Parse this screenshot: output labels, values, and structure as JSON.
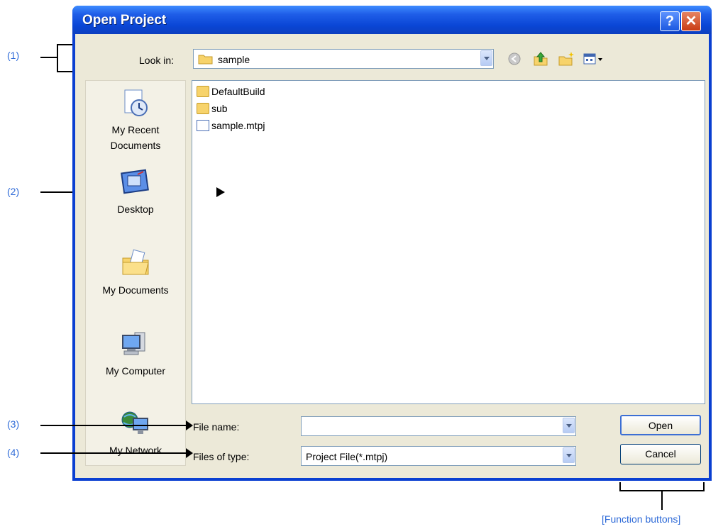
{
  "window": {
    "title": "Open Project",
    "help_glyph": "?",
    "close_glyph": "✕"
  },
  "look_in": {
    "label": "Look in:",
    "value": "sample"
  },
  "toolbar": {
    "icons": [
      "back-icon",
      "up-folder-icon",
      "new-folder-icon",
      "views-menu-icon"
    ]
  },
  "places": [
    {
      "label": "My Recent Documents",
      "icon": "recent-documents-icon"
    },
    {
      "label": "Desktop",
      "icon": "desktop-icon"
    },
    {
      "label": "My Documents",
      "icon": "my-documents-icon"
    },
    {
      "label": "My Computer",
      "icon": "my-computer-icon"
    },
    {
      "label": "My Network",
      "icon": "my-network-icon"
    }
  ],
  "files": [
    {
      "name": "DefaultBuild",
      "type": "folder"
    },
    {
      "name": "sub",
      "type": "folder"
    },
    {
      "name": "sample.mtpj",
      "type": "file"
    }
  ],
  "file_name": {
    "label": "File name:",
    "value": ""
  },
  "files_of_type": {
    "label": "Files of type:",
    "value": "Project File(*.mtpj)"
  },
  "buttons": {
    "open": "Open",
    "cancel": "Cancel"
  },
  "annotations": {
    "c1": "(1)",
    "c2": "(2)",
    "c3": "(3)",
    "c4": "(4)",
    "function_buttons": "[Function buttons]"
  },
  "colors": {
    "annotation": "#2f6bd8",
    "titlebar": "#0a46d6",
    "client": "#ece9d8"
  }
}
